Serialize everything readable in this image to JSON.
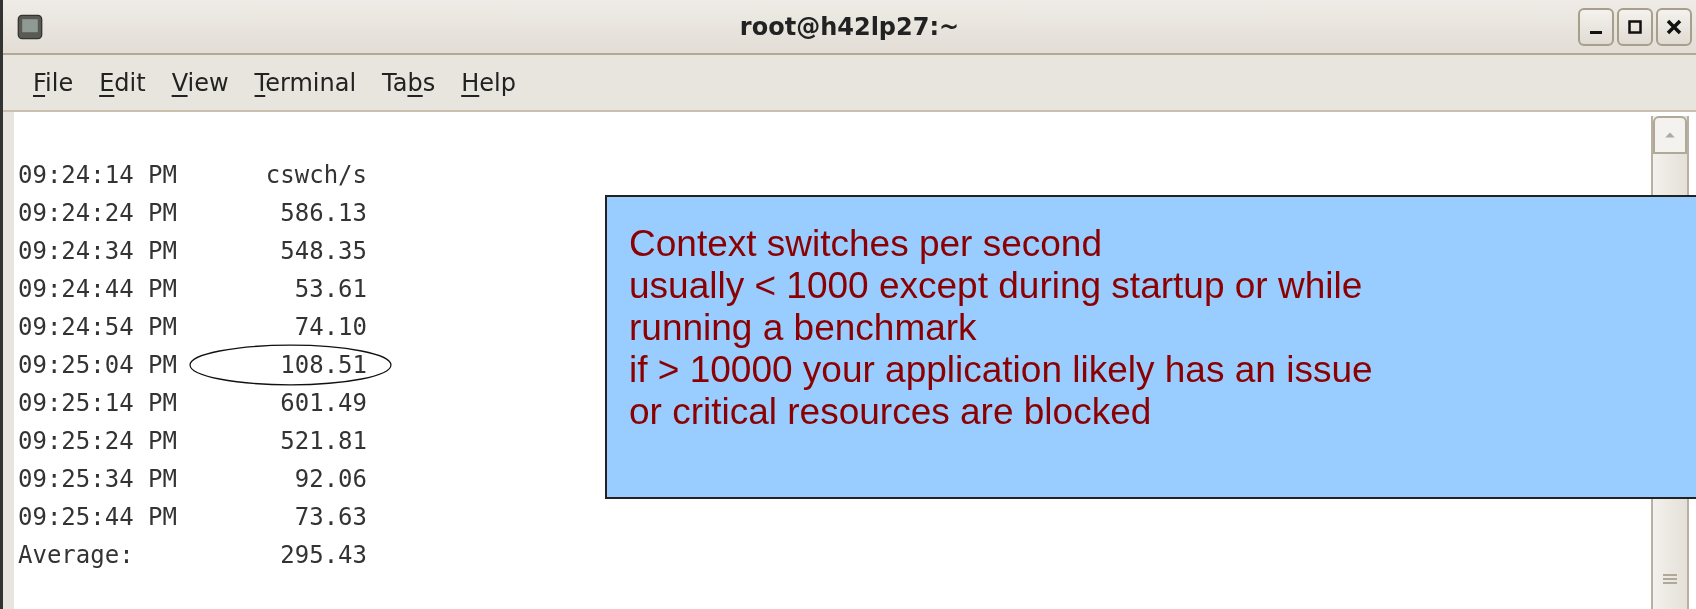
{
  "window": {
    "title": "root@h42lp27:~"
  },
  "menu": [
    {
      "access_key": "F",
      "after": "ile"
    },
    {
      "access_key": "E",
      "after": "dit"
    },
    {
      "access_key": "V",
      "after": "iew"
    },
    {
      "access_key": "T",
      "after": "erminal"
    },
    {
      "before": "Ta",
      "access_key": "b",
      "after": "s"
    },
    {
      "access_key": "H",
      "after": "elp"
    }
  ],
  "terminal": {
    "lines": [
      {
        "time": "09:24:14 PM",
        "value": "cswch/s",
        "circled": false
      },
      {
        "time": "09:24:24 PM",
        "value": "586.13",
        "circled": false
      },
      {
        "time": "09:24:34 PM",
        "value": "548.35",
        "circled": false
      },
      {
        "time": "09:24:44 PM",
        "value": "53.61",
        "circled": false
      },
      {
        "time": "09:24:54 PM",
        "value": "74.10",
        "circled": false
      },
      {
        "time": "09:25:04 PM",
        "value": "108.51",
        "circled": true
      },
      {
        "time": "09:25:14 PM",
        "value": "601.49",
        "circled": false
      },
      {
        "time": "09:25:24 PM",
        "value": "521.81",
        "circled": false
      },
      {
        "time": "09:25:34 PM",
        "value": "92.06",
        "circled": false
      },
      {
        "time": "09:25:44 PM",
        "value": "73.63",
        "circled": false
      },
      {
        "time": "Average:",
        "value": "295.43",
        "circled": false
      }
    ]
  },
  "callout": {
    "lines": [
      "Context switches per second",
      "usually < 1000 except during startup or while",
      "running a benchmark",
      "if > 10000 your application likely has an issue",
      "or critical resources are blocked"
    ]
  }
}
